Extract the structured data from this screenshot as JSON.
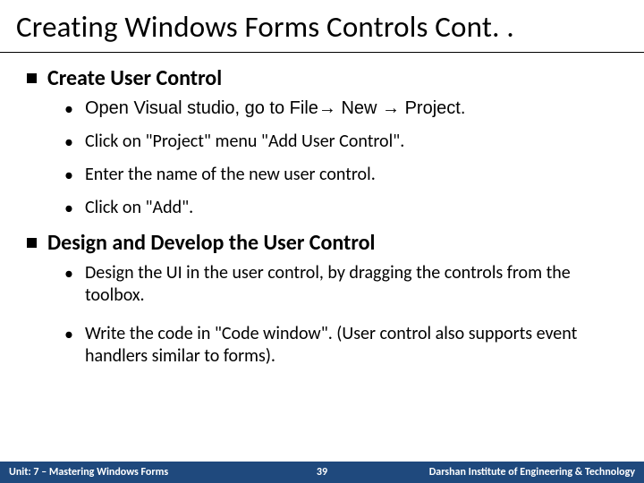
{
  "title": "Creating Windows Forms Controls Cont. .",
  "sections": [
    {
      "heading": "Create User Control",
      "bullets": [
        "Open Visual studio, go to File→ New → Project.",
        "Click on \"Project\" menu \"Add User Control\".",
        "Enter the name of the new user control.",
        "Click on \"Add\"."
      ]
    },
    {
      "heading": "Design and Develop the User Control",
      "bullets": [
        "Design the UI in the user control, by dragging the controls from the toolbox.",
        "Write the code in \"Code window\". (User control also supports event handlers similar to forms)."
      ]
    }
  ],
  "footer": {
    "left": "Unit: 7 – Mastering Windows Forms",
    "mid": "39",
    "right": "Darshan Institute of Engineering & Technology"
  }
}
